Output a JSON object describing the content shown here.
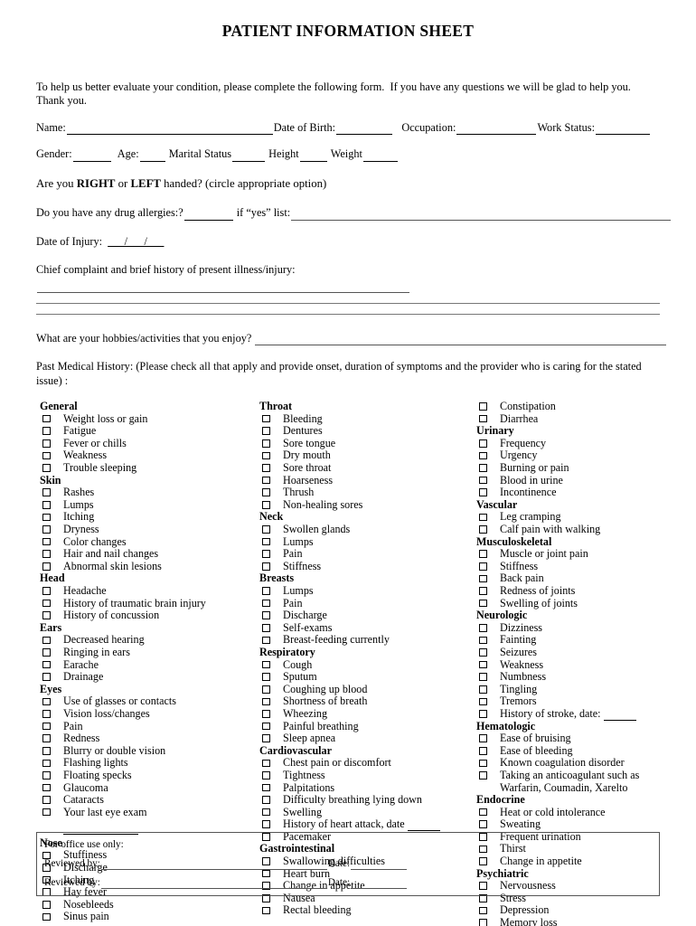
{
  "document": {
    "title": "PATIENT INFORMATION SHEET",
    "intro": "To help us better evaluate your condition, please complete the following form.  If you have any questions we will be glad to help you. Thank you."
  },
  "fields": {
    "name_label": "Name:",
    "dob_label": "Date of Birth:",
    "occupation_label": "Occupation:",
    "work_status_label": "Work Status:",
    "gender_label": "Gender:",
    "age_label": "Age:",
    "marital_status_label": "Marital Status",
    "height_label": "Height",
    "weight_label": "Weight",
    "handed_prefix": "Are you ",
    "handed_right": "RIGHT",
    "handed_or": " or ",
    "handed_left": "LEFT",
    "handed_suffix": " handed? (circle appropriate option)",
    "allergies_label": "Do you have any drug allergies:?",
    "allergies_list_label": "if “yes” list:",
    "date_of_injury_label": "Date of Injury:",
    "date_of_injury_value": "___/___/___",
    "chief_complaint_label": "Chief complaint and brief history of present illness/injury:",
    "hobbies_label": "What are your hobbies/activities that you enjoy?",
    "past_medical_history_label": "Past Medical History: (Please check all that apply and provide onset, duration of symptoms and the provider who is caring for the stated issue) :"
  },
  "checklist": {
    "column1": [
      {
        "type": "category",
        "label": "General"
      },
      {
        "type": "item",
        "label": "Weight loss or gain"
      },
      {
        "type": "item",
        "label": "Fatigue"
      },
      {
        "type": "item",
        "label": "Fever or chills"
      },
      {
        "type": "item",
        "label": "Weakness"
      },
      {
        "type": "item",
        "label": "Trouble sleeping"
      },
      {
        "type": "category",
        "label": "Skin"
      },
      {
        "type": "item",
        "label": "Rashes"
      },
      {
        "type": "item",
        "label": "Lumps"
      },
      {
        "type": "item",
        "label": "Itching"
      },
      {
        "type": "item",
        "label": "Dryness"
      },
      {
        "type": "item",
        "label": "Color changes"
      },
      {
        "type": "item",
        "label": "Hair and nail changes"
      },
      {
        "type": "item",
        "label": "Abnormal skin lesions"
      },
      {
        "type": "category",
        "label": "Head"
      },
      {
        "type": "item",
        "label": "Headache"
      },
      {
        "type": "item",
        "label": "History of traumatic brain injury"
      },
      {
        "type": "item",
        "label": "History of concussion"
      },
      {
        "type": "category",
        "label": "Ears"
      },
      {
        "type": "item",
        "label": "Decreased hearing"
      },
      {
        "type": "item",
        "label": "Ringing in ears"
      },
      {
        "type": "item",
        "label": "Earache"
      },
      {
        "type": "item",
        "label": "Drainage"
      },
      {
        "type": "category",
        "label": "Eyes"
      },
      {
        "type": "item",
        "label": "Use of glasses or contacts"
      },
      {
        "type": "item",
        "label": "Vision loss/changes"
      },
      {
        "type": "item",
        "label": "Pain"
      },
      {
        "type": "item",
        "label": "Redness"
      },
      {
        "type": "item",
        "label": "Blurry or double vision"
      },
      {
        "type": "item",
        "label": "Flashing lights"
      },
      {
        "type": "item",
        "label": "Floating specks"
      },
      {
        "type": "item",
        "label": "Glaucoma"
      },
      {
        "type": "item",
        "label": "Cataracts"
      },
      {
        "type": "item",
        "label": "Your last eye exam"
      },
      {
        "type": "blankline"
      },
      {
        "type": "category",
        "label": "Nose"
      },
      {
        "type": "item",
        "label": "Stuffiness"
      },
      {
        "type": "item",
        "label": "Discharge"
      },
      {
        "type": "item",
        "label": "Itching"
      },
      {
        "type": "item",
        "label": "Hay fever"
      },
      {
        "type": "item",
        "label": "Nosebleeds"
      },
      {
        "type": "item",
        "label": "Sinus pain"
      }
    ],
    "column2": [
      {
        "type": "category",
        "label": "Throat"
      },
      {
        "type": "item",
        "label": "Bleeding"
      },
      {
        "type": "item",
        "label": "Dentures"
      },
      {
        "type": "item",
        "label": "Sore tongue"
      },
      {
        "type": "item",
        "label": "Dry mouth"
      },
      {
        "type": "item",
        "label": "Sore throat"
      },
      {
        "type": "item",
        "label": "Hoarseness"
      },
      {
        "type": "item",
        "label": "Thrush"
      },
      {
        "type": "item",
        "label": "Non-healing sores"
      },
      {
        "type": "category",
        "label": "Neck"
      },
      {
        "type": "item",
        "label": "Swollen glands"
      },
      {
        "type": "item",
        "label": "Lumps"
      },
      {
        "type": "item",
        "label": "Pain"
      },
      {
        "type": "item",
        "label": "Stiffness"
      },
      {
        "type": "category",
        "label": "Breasts"
      },
      {
        "type": "item",
        "label": "Lumps"
      },
      {
        "type": "item",
        "label": "Pain"
      },
      {
        "type": "item",
        "label": "Discharge"
      },
      {
        "type": "item",
        "label": "Self-exams"
      },
      {
        "type": "item",
        "label": "Breast-feeding currently"
      },
      {
        "type": "category",
        "label": "Respiratory"
      },
      {
        "type": "item",
        "label": "Cough"
      },
      {
        "type": "item",
        "label": "Sputum"
      },
      {
        "type": "item",
        "label": "Coughing up blood"
      },
      {
        "type": "item",
        "label": "Shortness of breath"
      },
      {
        "type": "item",
        "label": "Wheezing"
      },
      {
        "type": "item",
        "label": "Painful breathing"
      },
      {
        "type": "item",
        "label": "Sleep apnea"
      },
      {
        "type": "category",
        "label": "Cardiovascular"
      },
      {
        "type": "item",
        "label": "Chest pain or discomfort"
      },
      {
        "type": "item",
        "label": "Tightness"
      },
      {
        "type": "item",
        "label": "Palpitations"
      },
      {
        "type": "item",
        "label": "Difficulty breathing lying down"
      },
      {
        "type": "item",
        "label": "Swelling"
      },
      {
        "type": "item",
        "label": "History of heart attack, date",
        "blank": true
      },
      {
        "type": "item",
        "label": "Pacemaker"
      },
      {
        "type": "category",
        "label": "Gastrointestinal"
      },
      {
        "type": "item",
        "label": "Swallowing difficulties"
      },
      {
        "type": "item",
        "label": "Heart burn"
      },
      {
        "type": "item",
        "label": "Change in appetite"
      },
      {
        "type": "item",
        "label": "Nausea"
      },
      {
        "type": "item",
        "label": "Rectal bleeding"
      }
    ],
    "column3": [
      {
        "type": "item",
        "label": "Constipation"
      },
      {
        "type": "item",
        "label": "Diarrhea"
      },
      {
        "type": "category",
        "label": "Urinary"
      },
      {
        "type": "item",
        "label": "Frequency"
      },
      {
        "type": "item",
        "label": "Urgency"
      },
      {
        "type": "item",
        "label": "Burning or pain"
      },
      {
        "type": "item",
        "label": "Blood in urine"
      },
      {
        "type": "item",
        "label": "Incontinence"
      },
      {
        "type": "category",
        "label": "Vascular"
      },
      {
        "type": "item",
        "label": "Leg cramping"
      },
      {
        "type": "item",
        "label": "Calf pain with walking"
      },
      {
        "type": "category",
        "label": "Musculoskeletal"
      },
      {
        "type": "item",
        "label": "Muscle or joint pain"
      },
      {
        "type": "item",
        "label": "Stiffness"
      },
      {
        "type": "item",
        "label": "Back pain"
      },
      {
        "type": "item",
        "label": "Redness of joints"
      },
      {
        "type": "item",
        "label": "Swelling of joints"
      },
      {
        "type": "category",
        "label": "Neurologic"
      },
      {
        "type": "item",
        "label": "Dizziness"
      },
      {
        "type": "item",
        "label": "Fainting"
      },
      {
        "type": "item",
        "label": "Seizures"
      },
      {
        "type": "item",
        "label": "Weakness"
      },
      {
        "type": "item",
        "label": "Numbness"
      },
      {
        "type": "item",
        "label": "Tingling"
      },
      {
        "type": "item",
        "label": "Tremors"
      },
      {
        "type": "item",
        "label": "History of stroke, date:",
        "blank": true
      },
      {
        "type": "category",
        "label": "Hematologic"
      },
      {
        "type": "item",
        "label": "Ease of bruising"
      },
      {
        "type": "item",
        "label": "Ease of bleeding"
      },
      {
        "type": "item",
        "label": "Known coagulation disorder"
      },
      {
        "type": "item",
        "label": "Taking an anticoagulant such as",
        "cont": "Warfarin, Coumadin, Xarelto"
      },
      {
        "type": "category",
        "label": "Endocrine"
      },
      {
        "type": "item",
        "label": "Heat or cold intolerance"
      },
      {
        "type": "item",
        "label": "Sweating"
      },
      {
        "type": "item",
        "label": "Frequent urination"
      },
      {
        "type": "item",
        "label": "Thirst"
      },
      {
        "type": "item",
        "label": "Change in appetite"
      },
      {
        "type": "category",
        "label": "Psychiatric"
      },
      {
        "type": "item",
        "label": "Nervousness"
      },
      {
        "type": "item",
        "label": "Stress"
      },
      {
        "type": "item",
        "label": "Depression"
      },
      {
        "type": "item",
        "label": "Memory loss"
      }
    ]
  },
  "office_use": {
    "title": "For office use only:",
    "reviewed_by_label": "Reviewed by:",
    "date_label": "Date:"
  }
}
